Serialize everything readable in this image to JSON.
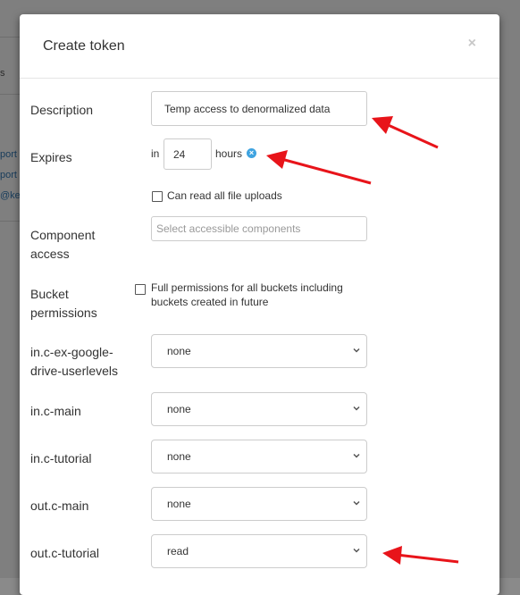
{
  "background": {
    "fragments": [
      "s",
      "port",
      "port",
      "@kel"
    ]
  },
  "modal": {
    "title": "Create token",
    "close": "×"
  },
  "form": {
    "description": {
      "label": "Description",
      "value": "Temp access to denormalized data"
    },
    "expires": {
      "label": "Expires",
      "prefix": "in",
      "value": "24",
      "suffix": "hours"
    },
    "file_uploads": {
      "label": "Can read all file uploads",
      "checked": false
    },
    "component_access": {
      "label_line1": "Component",
      "label_line2": "access",
      "placeholder": "Select accessible components"
    },
    "bucket_permissions": {
      "label_line1": "Bucket",
      "label_line2": "permissions",
      "checkbox_line1": "Full permissions for all buckets including",
      "checkbox_line2": "buckets created in future",
      "checked": false
    },
    "buckets": [
      {
        "label_line1": "in.c-ex-google-",
        "label_line2": "drive-userlevels",
        "value": "none"
      },
      {
        "label": "in.c-main",
        "value": "none"
      },
      {
        "label": "in.c-tutorial",
        "value": "none"
      },
      {
        "label": "out.c-main",
        "value": "none"
      },
      {
        "label": "out.c-tutorial",
        "value": "read"
      }
    ]
  },
  "colors": {
    "annotation_arrow": "#e8141a",
    "info_icon": "#3fa3e0"
  }
}
